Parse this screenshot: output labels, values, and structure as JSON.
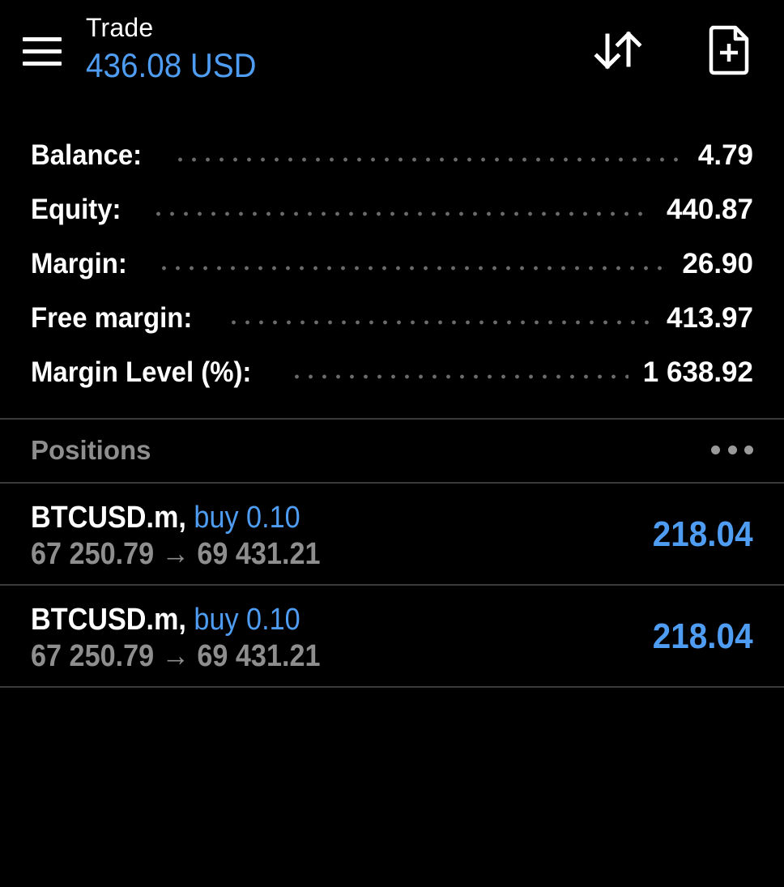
{
  "header": {
    "title": "Trade",
    "subtitle": "436.08 USD",
    "menu_icon": "hamburger-menu-icon",
    "sort_icon": "sort-arrows-icon",
    "new_order_icon": "new-document-icon"
  },
  "summary": [
    {
      "label": "Balance:",
      "value": "4.79"
    },
    {
      "label": "Equity:",
      "value": "440.87"
    },
    {
      "label": "Margin:",
      "value": "26.90"
    },
    {
      "label": "Free margin:",
      "value": "413.97"
    },
    {
      "label": "Margin Level (%):",
      "value": "1 638.92"
    }
  ],
  "positions": {
    "title": "Positions",
    "more_icon": "more-dots-icon",
    "items": [
      {
        "symbol": "BTCUSD.m,",
        "side": "buy 0.10",
        "open_price": "67 250.79",
        "arrow": "→",
        "current_price": "69 431.21",
        "profit": "218.04"
      },
      {
        "symbol": "BTCUSD.m,",
        "side": "buy 0.10",
        "open_price": "67 250.79",
        "arrow": "→",
        "current_price": "69 431.21",
        "profit": "218.04"
      }
    ]
  },
  "colors": {
    "background": "#000000",
    "accent_blue": "#4f9df2",
    "muted_text": "#8e8e8e",
    "divider": "#3a3a3a"
  }
}
